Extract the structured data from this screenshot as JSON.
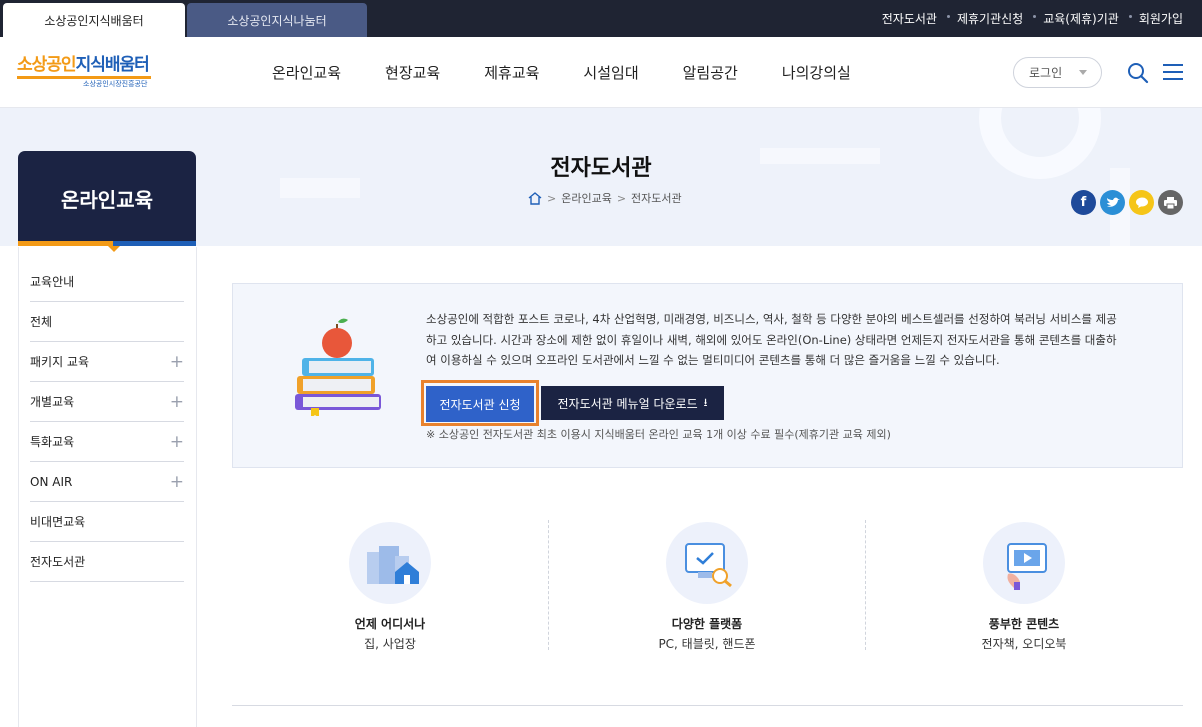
{
  "site_tabs": [
    "소상공인지식배움터",
    "소상공인지식나눔터"
  ],
  "util_links": [
    "전자도서관",
    "제휴기관신청",
    "교육(제휴)기관",
    "회원가입"
  ],
  "logo": {
    "main_a": "소상공인",
    "main_b": "지식배움터",
    "sub": "소상공인시장진흥공단"
  },
  "gnb": [
    "온라인교육",
    "현장교육",
    "제휴교육",
    "시설임대",
    "알림공간",
    "나의강의실"
  ],
  "login_label": "로그인",
  "page_title": "전자도서관",
  "breadcrumb": [
    "온라인교육",
    "전자도서관"
  ],
  "lnb": {
    "title": "온라인교육",
    "items": [
      {
        "label": "교육안내",
        "has_sub": false
      },
      {
        "label": "전체",
        "has_sub": false
      },
      {
        "label": "패키지 교육",
        "has_sub": true
      },
      {
        "label": "개별교육",
        "has_sub": true
      },
      {
        "label": "특화교육",
        "has_sub": true
      },
      {
        "label": "ON AIR",
        "has_sub": true
      },
      {
        "label": "비대면교육",
        "has_sub": false
      },
      {
        "label": "전자도서관",
        "has_sub": false
      }
    ]
  },
  "intro": {
    "line1": "소상공인에 적합한 포스트 코로나, 4차 산업혁명, 미래경영, 비즈니스, 역사, 철학 등 다양한 분야의 베스트셀러를 선정하여 북러닝 서비스를 제공",
    "line2": "하고 있습니다. 시간과 장소에 제한 없이 휴일이나 새벽, 해외에 있어도 온라인(On-Line) 상태라면 언제든지 전자도서관을 통해 콘텐츠를 대출하",
    "line3": "여 이용하실 수 있으며 오프라인 도서관에서 느낄 수 없는 멀티미디어 콘텐츠를 통해 더 많은 즐거움을 느낄 수 있습니다.",
    "apply_btn": "전자도서관 신청",
    "manual_btn": "전자도서관 메뉴얼 다운로드",
    "notice": "※ 소상공인 전자도서관 최초 이용시 지식배움터 온라인 교육 1개 이상 수료 필수(제휴기관 교육 제외)"
  },
  "features": [
    {
      "title": "언제 어디서나",
      "sub": "집, 사업장",
      "icon": "building-home-icon"
    },
    {
      "title": "다양한 플랫폼",
      "sub": "PC, 태블릿, 핸드폰",
      "icon": "monitor-check-icon"
    },
    {
      "title": "풍부한 콘텐츠",
      "sub": "전자책, 오디오북",
      "icon": "video-play-icon"
    }
  ],
  "colors": {
    "navy": "#1b2343",
    "orange": "#f39a16",
    "blue": "#2f62c9",
    "highlight": "#e8822e"
  }
}
